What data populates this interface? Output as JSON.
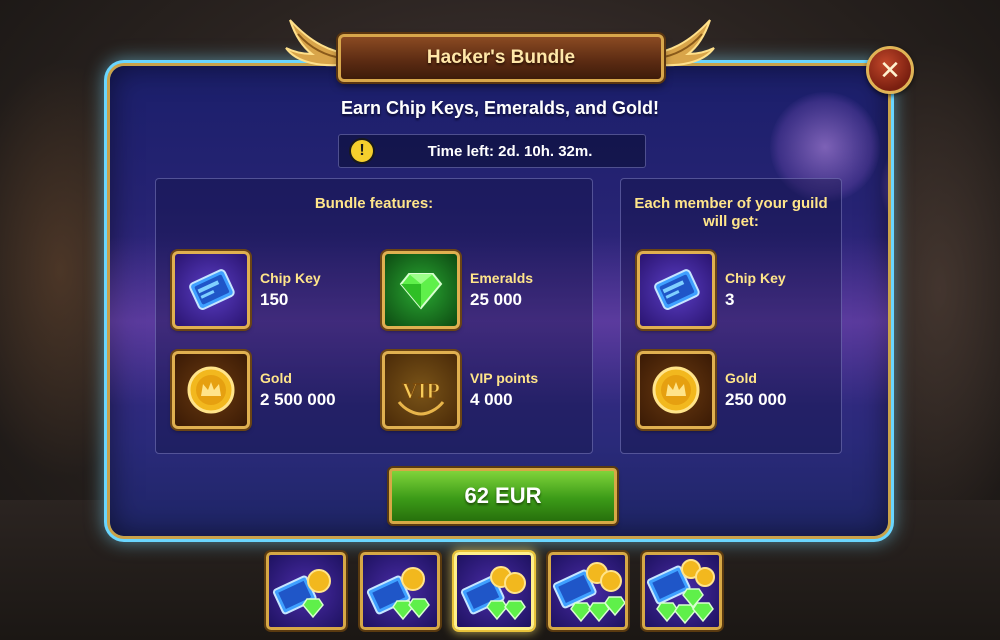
{
  "title": "Hacker's Bundle",
  "subtitle": "Earn Chip Keys, Emeralds, and Gold!",
  "timer": {
    "text": "Time left: 2d. 10h. 32m.",
    "icon": "exclamation-icon"
  },
  "close": {
    "icon": "close-icon",
    "symbol": "✕"
  },
  "features": {
    "title": "Bundle features:",
    "items": [
      {
        "name": "Chip Key",
        "value": "150",
        "icon": "chip-key-icon"
      },
      {
        "name": "Emeralds",
        "value": "25 000",
        "icon": "emerald-icon"
      },
      {
        "name": "Gold",
        "value": "2 500 000",
        "icon": "gold-coin-icon"
      },
      {
        "name": "VIP points",
        "value": "4 000",
        "icon": "vip-icon"
      }
    ]
  },
  "guild": {
    "title": "Each member of your guild will get:",
    "items": [
      {
        "name": "Chip Key",
        "value": "3",
        "icon": "chip-key-icon"
      },
      {
        "name": "Gold",
        "value": "250 000",
        "icon": "gold-coin-icon"
      }
    ]
  },
  "buy_button": {
    "label": "62 EUR"
  },
  "tiers": {
    "count": 5,
    "selected_index": 2
  },
  "colors": {
    "accent_gold": "#ffe58a",
    "button_green": "#3c9b18",
    "panel_blue": "#262373",
    "frame_cyan": "#6ad6ff"
  }
}
